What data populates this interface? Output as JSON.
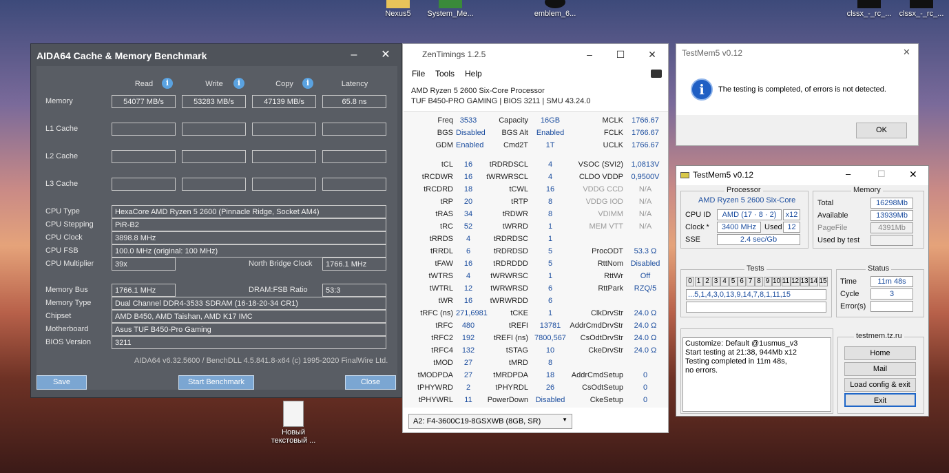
{
  "desktop": {
    "icons": [
      {
        "label": "Nexus5"
      },
      {
        "label": "System_Me..."
      },
      {
        "label": "emblem_6..."
      },
      {
        "label": "clssx_-_rc_..."
      },
      {
        "label": "clssx_-_rc_..."
      },
      {
        "label": "Новый текстовый ..."
      }
    ]
  },
  "aida": {
    "title": "AIDA64 Cache & Memory Benchmark",
    "minimize": "–",
    "close": "✕",
    "columns": {
      "read": "Read",
      "write": "Write",
      "copy": "Copy",
      "latency": "Latency"
    },
    "info_icon": "i",
    "rows": {
      "memory": {
        "label": "Memory",
        "read": "54077 MB/s",
        "write": "53283 MB/s",
        "copy": "47139 MB/s",
        "latency": "65.8 ns"
      },
      "l1": {
        "label": "L1 Cache"
      },
      "l2": {
        "label": "L2 Cache"
      },
      "l3": {
        "label": "L3 Cache"
      }
    },
    "info": {
      "cpu_type_label": "CPU Type",
      "cpu_type": "HexaCore AMD Ryzen 5 2600  (Pinnacle Ridge, Socket AM4)",
      "cpu_stepping_label": "CPU Stepping",
      "cpu_stepping": "PiR-B2",
      "cpu_clock_label": "CPU Clock",
      "cpu_clock": "3898.8 MHz",
      "cpu_fsb_label": "CPU FSB",
      "cpu_fsb": "100.0 MHz  (original: 100 MHz)",
      "cpu_mult_label": "CPU Multiplier",
      "cpu_mult": "39x",
      "nb_clock_label": "North Bridge Clock",
      "nb_clock": "1766.1 MHz",
      "mem_bus_label": "Memory Bus",
      "mem_bus": "1766.1 MHz",
      "dram_ratio_label": "DRAM:FSB Ratio",
      "dram_ratio": "53:3",
      "mem_type_label": "Memory Type",
      "mem_type": "Dual Channel DDR4-3533 SDRAM  (16-18-20-34 CR1)",
      "chipset_label": "Chipset",
      "chipset": "AMD B450, AMD Taishan, AMD K17 IMC",
      "mobo_label": "Motherboard",
      "mobo": "Asus TUF B450-Pro Gaming",
      "bios_label": "BIOS Version",
      "bios": "3211"
    },
    "footer": "AIDA64 v6.32.5600 / BenchDLL 4.5.841.8-x64  (c) 1995-2020 FinalWire Ltd.",
    "buttons": {
      "save": "Save",
      "start": "Start Benchmark",
      "close": "Close"
    }
  },
  "zen": {
    "title": "ZenTimings 1.2.5",
    "logo": "Z",
    "menu": [
      "File",
      "Tools",
      "Help"
    ],
    "cpu": "AMD Ryzen 5 2600 Six-Core Processor",
    "board": "TUF B450-PRO GAMING | BIOS 3211 | SMU 43.24.0",
    "col1": [
      [
        "Freq",
        "3533"
      ],
      [
        "BGS",
        "Disabled"
      ],
      [
        "GDM",
        "Enabled"
      ],
      [
        "",
        ""
      ],
      [
        "tCL",
        "16"
      ],
      [
        "tRCDWR",
        "16"
      ],
      [
        "tRCDRD",
        "18"
      ],
      [
        "tRP",
        "20"
      ],
      [
        "tRAS",
        "34"
      ],
      [
        "tRC",
        "52"
      ],
      [
        "tRRDS",
        "4"
      ],
      [
        "tRRDL",
        "6"
      ],
      [
        "tFAW",
        "16"
      ],
      [
        "tWTRS",
        "4"
      ],
      [
        "tWTRL",
        "12"
      ],
      [
        "tWR",
        "16"
      ],
      [
        "tRFC (ns)",
        "271,6981"
      ],
      [
        "tRFC",
        "480"
      ],
      [
        "tRFC2",
        "192"
      ],
      [
        "tRFC4",
        "132"
      ],
      [
        "tMOD",
        "27"
      ],
      [
        "tMODPDA",
        "27"
      ],
      [
        "tPHYWRD",
        "2"
      ],
      [
        "tPHYWRL",
        "11"
      ]
    ],
    "col2": [
      [
        "Capacity",
        "16GB"
      ],
      [
        "BGS Alt",
        "Enabled"
      ],
      [
        "Cmd2T",
        "1T"
      ],
      [
        "",
        ""
      ],
      [
        "tRDRDSCL",
        "4"
      ],
      [
        "tWRWRSCL",
        "4"
      ],
      [
        "tCWL",
        "16"
      ],
      [
        "tRTP",
        "8"
      ],
      [
        "tRDWR",
        "8"
      ],
      [
        "tWRRD",
        "1"
      ],
      [
        "tRDRDSC",
        "1"
      ],
      [
        "tRDRDSD",
        "5"
      ],
      [
        "tRDRDDD",
        "5"
      ],
      [
        "tWRWRSC",
        "1"
      ],
      [
        "tWRWRSD",
        "6"
      ],
      [
        "tWRWRDD",
        "6"
      ],
      [
        "tCKE",
        "1"
      ],
      [
        "tREFI",
        "13781"
      ],
      [
        "tREFI (ns)",
        "7800,567"
      ],
      [
        "tSTAG",
        "10"
      ],
      [
        "tMRD",
        "8"
      ],
      [
        "tMRDPDA",
        "18"
      ],
      [
        "tPHYRDL",
        "26"
      ],
      [
        "PowerDown",
        "Disabled"
      ]
    ],
    "col3": [
      [
        "MCLK",
        "1766.67"
      ],
      [
        "FCLK",
        "1766.67"
      ],
      [
        "UCLK",
        "1766.67"
      ],
      [
        "",
        ""
      ],
      [
        "VSOC (SVI2)",
        "1,0813V"
      ],
      [
        "CLDO VDDP",
        "0,9500V"
      ],
      [
        "VDDG CCD",
        "N/A"
      ],
      [
        "VDDG IOD",
        "N/A"
      ],
      [
        "VDIMM",
        "N/A"
      ],
      [
        "MEM VTT",
        "N/A"
      ],
      [
        "",
        ""
      ],
      [
        "ProcODT",
        "53.3 Ω"
      ],
      [
        "RttNom",
        "Disabled"
      ],
      [
        "RttWr",
        "Off"
      ],
      [
        "RttPark",
        "RZQ/5"
      ],
      [
        "",
        ""
      ],
      [
        "ClkDrvStr",
        "24.0 Ω"
      ],
      [
        "AddrCmdDrvStr",
        "24.0 Ω"
      ],
      [
        "CsOdtDrvStr",
        "24.0 Ω"
      ],
      [
        "CkeDrvStr",
        "24.0 Ω"
      ],
      [
        "",
        ""
      ],
      [
        "AddrCmdSetup",
        "0"
      ],
      [
        "CsOdtSetup",
        "0"
      ],
      [
        "CkeSetup",
        "0"
      ]
    ],
    "dimm_select": "A2: F4-3600C19-8GSXWB (8GB, SR)"
  },
  "tm1": {
    "title": "TestMem5 v0.12",
    "message": "The testing is completed, of errors is not detected.",
    "ok": "OK"
  },
  "tm2": {
    "title": "TestMem5 v0.12",
    "processor_title": "Processor",
    "proc_name": "AMD Ryzen 5 2600 Six-Core",
    "cpuid_label": "CPU ID",
    "cpuid": "AMD  (17 · 8 · 2)",
    "threads": "x12",
    "clock_label": "Clock *",
    "clock": "3400 MHz",
    "used_label": "Used",
    "used": "12",
    "sse_label": "SSE",
    "sse": "2.4 sec/Gb",
    "memory_title": "Memory",
    "total_label": "Total",
    "total": "16298Mb",
    "avail_label": "Available",
    "avail": "13939Mb",
    "pagefile_label": "PageFile",
    "pagefile": "4391Mb",
    "usedbytest_label": "Used by test",
    "usedbytest": "",
    "tests_title": "Tests",
    "test_cells": [
      "0",
      "1",
      "2",
      "3",
      "4",
      "5",
      "6",
      "7",
      "8",
      "9",
      "10",
      "11",
      "12",
      "13",
      "14",
      "15"
    ],
    "test_seq": "...5,1,4,3,0,13,9,14,7,8,1,11,15",
    "status_title": "Status",
    "time_label": "Time",
    "time": "11m 48s",
    "cycle_label": "Cycle",
    "cycle": "3",
    "errors_label": "Error(s)",
    "errors": "",
    "log": [
      "Customize: Default @1usmus_v3",
      "Start testing at 21:38, 944Mb x12",
      "Testing completed in 11m 48s,",
      "no errors."
    ],
    "site_title": "testmem.tz.ru",
    "buttons": {
      "home": "Home",
      "mail": "Mail",
      "load": "Load config & exit",
      "exit": "Exit"
    }
  }
}
